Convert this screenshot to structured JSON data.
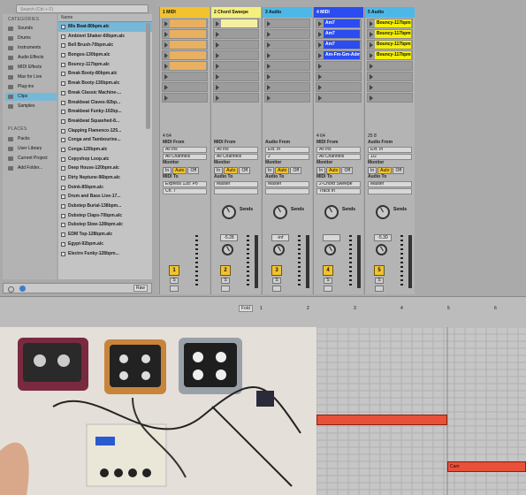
{
  "browser": {
    "search_placeholder": "Search (Ctrl + F)",
    "categories_header": "CATEGORIES",
    "categories": [
      "Sounds",
      "Drums",
      "Instruments",
      "Audio Effects",
      "MIDI Effects",
      "Max for Live",
      "Plug-ins",
      "Clips",
      "Samples"
    ],
    "places_header": "PLACES",
    "places": [
      "Packs",
      "User Library",
      "Current Project",
      "Add Folder..."
    ],
    "files_header": "Name",
    "files": [
      "80s Beat-80bpm.alc",
      "Ambient Shaker-60bpm.alc",
      "Bell Brush-70bpm.alc",
      "Bongos-130bpm.alc",
      "Bouncy-117bpm.alc",
      "Break Booty-80bpm.alc",
      "Break Booty-130bpm.alc",
      "Break Classic Machine-...",
      "Breakbeat Claves-92bp...",
      "Breakbeat Funky-102bp...",
      "Breakbeat Squashed-8...",
      "Clapping Flamenco-125...",
      "Conga and Tambourine...",
      "Conga-120bpm.alc",
      "Copyshop Loop.alc",
      "Deep House-120bpm.alc",
      "Dirty Neptune-96bpm.alc",
      "Doink-85bpm.alc",
      "Drum and Bass Live-17...",
      "Dubstep Burial-138bpm...",
      "Dubstep Claps-70bpm.alc",
      "Dubstep Slow-128bpm.alc",
      "EDM Top-128bpm.alc",
      "Egypt-92bpm.alc",
      "Electro Funky-128bpm..."
    ],
    "preview_raw": "Raw"
  },
  "tracks": [
    {
      "name": "1 MIDI",
      "color": "#f2c230",
      "from_label": "MIDI From",
      "from": "All Ins",
      "channel": "All Channels",
      "monitor": [
        "In",
        "Auto",
        "Off"
      ],
      "to_label": "MIDI To",
      "to": "Express 128: Po",
      "to2": "Ch. 7",
      "volume": "",
      "number": "1",
      "clips": [
        {
          "name": "",
          "color": "#e8b060"
        },
        {
          "name": "",
          "color": "#e8b060"
        },
        {
          "name": "",
          "color": "#e8b060"
        },
        {
          "name": "",
          "color": "#e8b060"
        },
        {
          "name": "",
          "color": "#e8b060"
        }
      ],
      "status": [
        "4",
        "64"
      ]
    },
    {
      "name": "2 Chord Sweepe",
      "color": "#f5f07a",
      "from_label": "MIDI From",
      "from": "All Ins",
      "channel": "All Channels",
      "monitor": [
        "In",
        "Auto",
        "Off"
      ],
      "to_label": "Audio To",
      "to": "Master",
      "to2": "",
      "volume": "-5.28",
      "number": "2",
      "clips": [
        {
          "name": "",
          "color": "#f5f0a0"
        }
      ],
      "status": []
    },
    {
      "name": "3 Audio",
      "color": "#4db8e8",
      "from_label": "Audio From",
      "from": "Ext. In",
      "channel": "2",
      "monitor": [
        "In",
        "Auto",
        "Off"
      ],
      "to_label": "Audio To",
      "to": "Master",
      "to2": "",
      "volume": "-inf",
      "number": "3",
      "clips": [],
      "status": []
    },
    {
      "name": "4 MIDI",
      "color": "#2a4cf0",
      "from_label": "MIDI From",
      "from": "All Ins",
      "channel": "All Channels",
      "monitor": [
        "In",
        "Auto",
        "Off"
      ],
      "to_label": "MIDI To",
      "to": "2-Chord Sweepe",
      "to2": "Track In",
      "volume": "",
      "number": "4",
      "clips": [
        {
          "name": "Am7",
          "color": "#2a4cf0"
        },
        {
          "name": "Am7",
          "color": "#2a4cf0"
        },
        {
          "name": "Am7",
          "color": "#2a4cf0"
        },
        {
          "name": "Am-Fm-Gm-Adm",
          "color": "#2a4cf0"
        }
      ],
      "status": [
        "4",
        "64"
      ]
    },
    {
      "name": "5 Audio",
      "color": "#4db8e8",
      "from_label": "Audio From",
      "from": "Ext. In",
      "channel": "1/2",
      "monitor": [
        "In",
        "Auto",
        "Off"
      ],
      "to_label": "Audio To",
      "to": "Master",
      "to2": "",
      "volume": "-5.30",
      "number": "5",
      "clips": [
        {
          "name": "Bouncy-117bpm",
          "color": "#f5f000"
        },
        {
          "name": "Bouncy-117bpm",
          "color": "#f5f000"
        },
        {
          "name": "Bouncy-117bpm",
          "color": "#f5f000"
        },
        {
          "name": "Bouncy-117bpm",
          "color": "#f5f000"
        }
      ],
      "status": [
        "25",
        "8"
      ]
    }
  ],
  "mixer": {
    "sends_label": "Sends",
    "monitor_label": "Monitor",
    "scale": [
      "0",
      "12",
      "24",
      "36",
      "48",
      "60"
    ],
    "solo": "S"
  },
  "arrangement": {
    "fold": "Fold",
    "ruler": [
      "1",
      "2",
      "3",
      "4",
      "5",
      "6"
    ]
  },
  "piano_roll": {
    "note_label": "Cam"
  }
}
